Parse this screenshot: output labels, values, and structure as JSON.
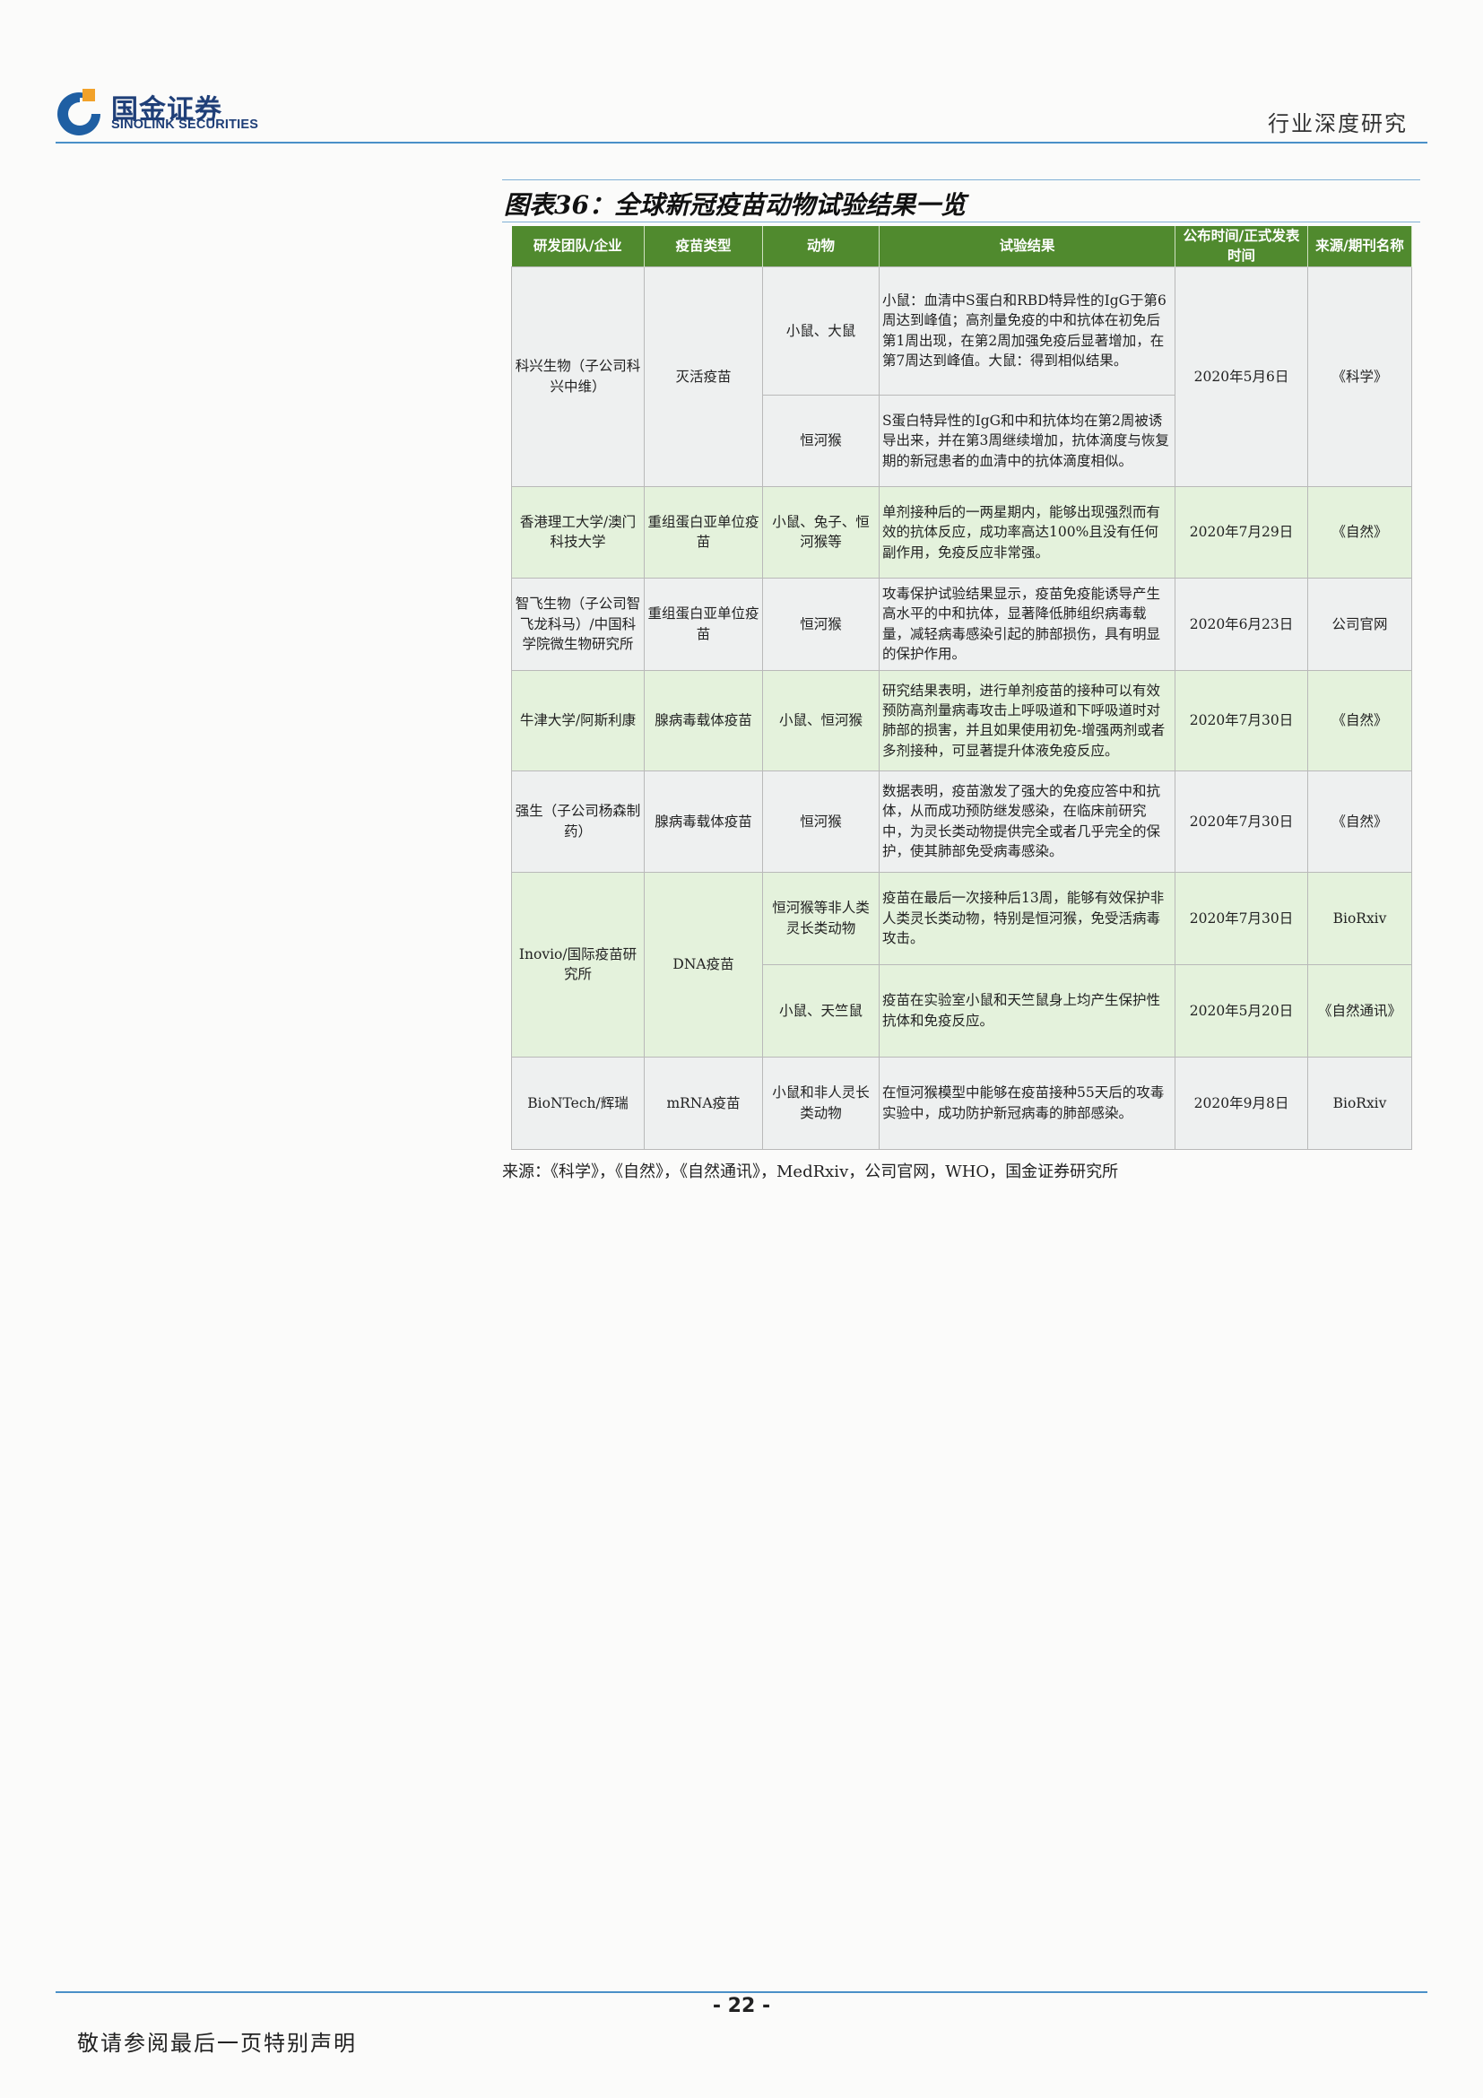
{
  "header": {
    "logo_cn": "国金证券",
    "logo_en": "SINOLINK SECURITIES",
    "section": "行业深度研究"
  },
  "figure": {
    "title": "图表36：全球新冠疫苗动物试验结果一览",
    "source": "来源：《科学》，《自然》，《自然通讯》，MedRxiv，公司官网，WHO，国金证券研究所"
  },
  "table": {
    "columns": [
      "研发团队/企业",
      "疫苗类型",
      "动物",
      "试验结果",
      "公布时间/正式发表时间",
      "来源/期刊名称"
    ],
    "rows": [
      {
        "company": "科兴生物（子公司科兴中维）",
        "type": "灭活疫苗",
        "date": "2020年5月6日",
        "source": "《科学》",
        "sub": [
          {
            "animal": "小鼠、大鼠",
            "result": "小鼠：血清中S蛋白和RBD特异性的IgG于第6周达到峰值；高剂量免疫的中和抗体在初免后第1周出现，在第2周加强免疫后显著增加，在第7周达到峰值。大鼠：得到相似结果。"
          },
          {
            "animal": "恒河猴",
            "result": "S蛋白特异性的IgG和中和抗体均在第2周被诱导出来，并在第3周继续增加，抗体滴度与恢复期的新冠患者的血清中的抗体滴度相似。"
          }
        ]
      },
      {
        "company": "香港理工大学/澳门科技大学",
        "type": "重组蛋白亚单位疫苗",
        "animal": "小鼠、兔子、恒河猴等",
        "result": "单剂接种后的一两星期内，能够出现强烈而有效的抗体反应，成功率高达100%且没有任何副作用，免疫反应非常强。",
        "date": "2020年7月29日",
        "source": "《自然》"
      },
      {
        "company": "智飞生物（子公司智飞龙科马）/中国科学院微生物研究所",
        "type": "重组蛋白亚单位疫苗",
        "animal": "恒河猴",
        "result": "攻毒保护试验结果显示，疫苗免疫能诱导产生高水平的中和抗体，显著降低肺组织病毒载量，减轻病毒感染引起的肺部损伤，具有明显的保护作用。",
        "date": "2020年6月23日",
        "source": "公司官网"
      },
      {
        "company": "牛津大学/阿斯利康",
        "type": "腺病毒载体疫苗",
        "animal": "小鼠、恒河猴",
        "result": "研究结果表明，进行单剂疫苗的接种可以有效预防高剂量病毒攻击上呼吸道和下呼吸道时对肺部的损害，并且如果使用初免-增强两剂或者多剂接种，可显著提升体液免疫反应。",
        "date": "2020年7月30日",
        "source": "《自然》"
      },
      {
        "company": "强生（子公司杨森制药）",
        "type": "腺病毒载体疫苗",
        "animal": "恒河猴",
        "result": "数据表明，疫苗激发了强大的免疫应答中和抗体，从而成功预防继发感染，在临床前研究中，为灵长类动物提供完全或者几乎完全的保护，使其肺部免受病毒感染。",
        "date": "2020年7月30日",
        "source": "《自然》"
      },
      {
        "company": "Inovio/国际疫苗研究所",
        "type": "DNA疫苗",
        "sub": [
          {
            "animal": "恒河猴等非人类灵长类动物",
            "result": "疫苗在最后一次接种后13周，能够有效保护非人类灵长类动物，特别是恒河猴，免受活病毒攻击。",
            "date": "2020年7月30日",
            "source": "BioRxiv"
          },
          {
            "animal": "小鼠、天竺鼠",
            "result": "疫苗在实验室小鼠和天竺鼠身上均产生保护性抗体和免疫反应。",
            "date": "2020年5月20日",
            "source": "《自然通讯》"
          }
        ]
      },
      {
        "company": "BioNTech/辉瑞",
        "type": "mRNA疫苗",
        "animal": "小鼠和非人灵长类动物",
        "result": "在恒河猴模型中能够在疫苗接种55天后的攻毒实验中，成功防护新冠病毒的肺部感染。",
        "date": "2020年9月8日",
        "source": "BioRxiv"
      }
    ]
  },
  "footer": {
    "page": "- 22 -",
    "note": "敬请参阅最后一页特别声明"
  }
}
